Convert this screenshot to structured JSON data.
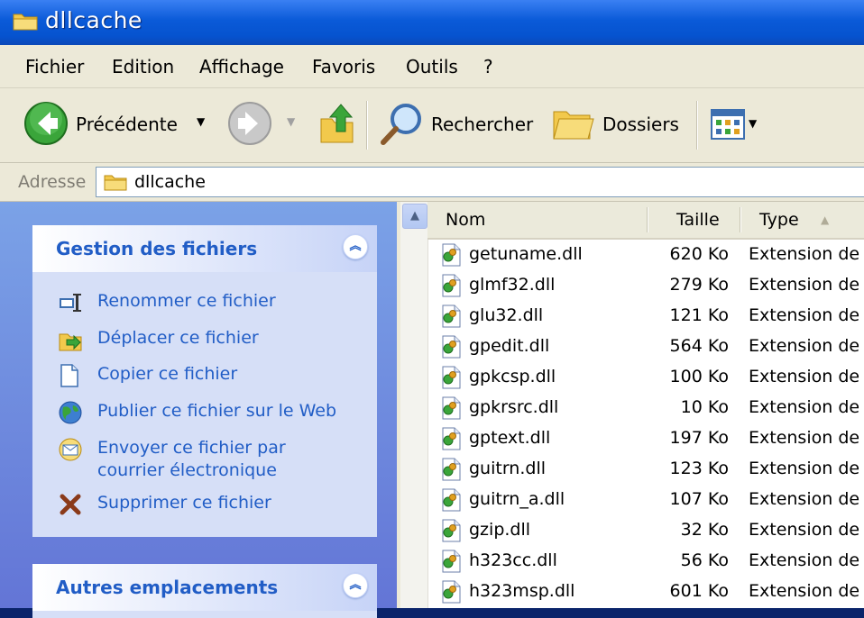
{
  "window": {
    "title": "dllcache"
  },
  "menu": [
    "Fichier",
    "Edition",
    "Affichage",
    "Favoris",
    "Outils",
    "?"
  ],
  "toolbar": {
    "back": "Précédente",
    "search": "Rechercher",
    "folders": "Dossiers"
  },
  "address": {
    "label": "Adresse",
    "value": "dllcache"
  },
  "panels": {
    "file_tasks": {
      "title": "Gestion des fichiers",
      "items": [
        {
          "icon": "rename-icon",
          "label": "Renommer ce fichier"
        },
        {
          "icon": "move-icon",
          "label": "Déplacer ce fichier"
        },
        {
          "icon": "copy-icon",
          "label": "Copier ce fichier"
        },
        {
          "icon": "globe-icon",
          "label": "Publier ce fichier sur le Web"
        },
        {
          "icon": "email-icon",
          "label": "Envoyer ce fichier par",
          "label2": "courrier électronique"
        },
        {
          "icon": "delete-icon",
          "label": "Supprimer ce fichier"
        }
      ]
    },
    "other_places": {
      "title": "Autres emplacements"
    }
  },
  "columns": {
    "name": "Nom",
    "size": "Taille",
    "type": "Type"
  },
  "files": [
    {
      "name": "getuname.dll",
      "size": "620 Ko",
      "type": "Extension de"
    },
    {
      "name": "glmf32.dll",
      "size": "279 Ko",
      "type": "Extension de"
    },
    {
      "name": "glu32.dll",
      "size": "121 Ko",
      "type": "Extension de"
    },
    {
      "name": "gpedit.dll",
      "size": "564 Ko",
      "type": "Extension de"
    },
    {
      "name": "gpkcsp.dll",
      "size": "100 Ko",
      "type": "Extension de"
    },
    {
      "name": "gpkrsrc.dll",
      "size": "10 Ko",
      "type": "Extension de"
    },
    {
      "name": "gptext.dll",
      "size": "197 Ko",
      "type": "Extension de"
    },
    {
      "name": "guitrn.dll",
      "size": "123 Ko",
      "type": "Extension de"
    },
    {
      "name": "guitrn_a.dll",
      "size": "107 Ko",
      "type": "Extension de"
    },
    {
      "name": "gzip.dll",
      "size": "32 Ko",
      "type": "Extension de"
    },
    {
      "name": "h323cc.dll",
      "size": "56 Ko",
      "type": "Extension de"
    },
    {
      "name": "h323msp.dll",
      "size": "601 Ko",
      "type": "Extension de"
    }
  ]
}
